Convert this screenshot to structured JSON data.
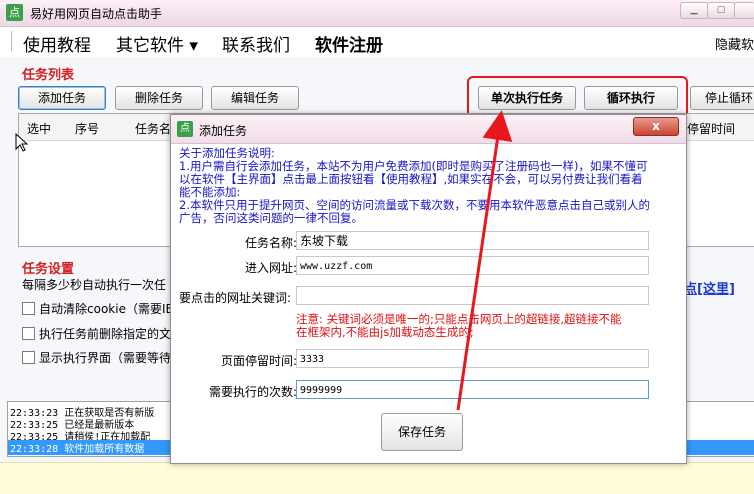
{
  "app": {
    "title": "易好用网页自动点击助手",
    "icon_glyph": "点"
  },
  "menu": {
    "items": [
      "使用教程",
      "其它软件 ▾",
      "联系我们",
      "软件注册"
    ],
    "hide": "隐藏软"
  },
  "task_list": {
    "title": "任务列表",
    "buttons": {
      "add": "添加任务",
      "delete": "删除任务",
      "edit": "编辑任务",
      "run_once": "单次执行任务",
      "loop": "循环执行",
      "stop": "停止循环"
    },
    "columns": [
      "选中",
      "序号",
      "任务名",
      "停留时间"
    ]
  },
  "settings": {
    "title": "任务设置",
    "interval_text": "每隔多少秒自动执行一次任",
    "opt_cookie": "自动清除cookie（需要IE",
    "opt_delete": "执行任务前删除指定的文",
    "opt_show": "显示执行界面（需要等待",
    "link_fragment": "点[这里]"
  },
  "log": [
    {
      "time": "22:33:23",
      "text": "正在获取是否有新版",
      "selected": false
    },
    {
      "time": "22:33:25",
      "text": "已经是最新版本",
      "selected": false
    },
    {
      "time": "22:33:25",
      "text": "请稍侯!正在加载配",
      "selected": false
    },
    {
      "time": "22:33:28",
      "text": "软件加载所有数据",
      "selected": true
    }
  ],
  "dialog": {
    "title": "添加任务",
    "close_glyph": "x",
    "notes": [
      "关于添加任务说明:",
      "1.用户需自行会添加任务，本站不为用户免费添加(即时是购买了注册码也一样)，如果不懂可",
      "以在软件【主界面】点击最上面按钮看【使用教程】,如果实在不会，可以另付费让我们看着",
      "能不能添加:",
      "2.本软件只用于提升网页、空间的访问流量或下载次数，不要用本软件恶意点击自己或别人的",
      "广告，否问这类问题的一律不回复。"
    ],
    "fields": {
      "task_name": {
        "label": "任务名称:",
        "value": "东坡下载"
      },
      "url": {
        "label": "进入网址:",
        "value": "www.uzzf.com"
      },
      "keyword": {
        "label": "要点击的网址关键词:",
        "value": ""
      },
      "stay_time": {
        "label": "页面停留时间:",
        "value": "3333"
      },
      "count": {
        "label": "需要执行的次数:",
        "value": "9999999"
      }
    },
    "warning": [
      "注意: 关键词必须是唯一的;只能点击网页上的超链接,超链接不能",
      "在框架内,不能由js加载动态生成的;"
    ],
    "save": "保存任务"
  },
  "colors": {
    "highlight": "#e8161d",
    "arrow": "#e8161d",
    "section_red": "#d12121",
    "note_blue": "#1515c4",
    "log_selected": "#3399ff"
  }
}
